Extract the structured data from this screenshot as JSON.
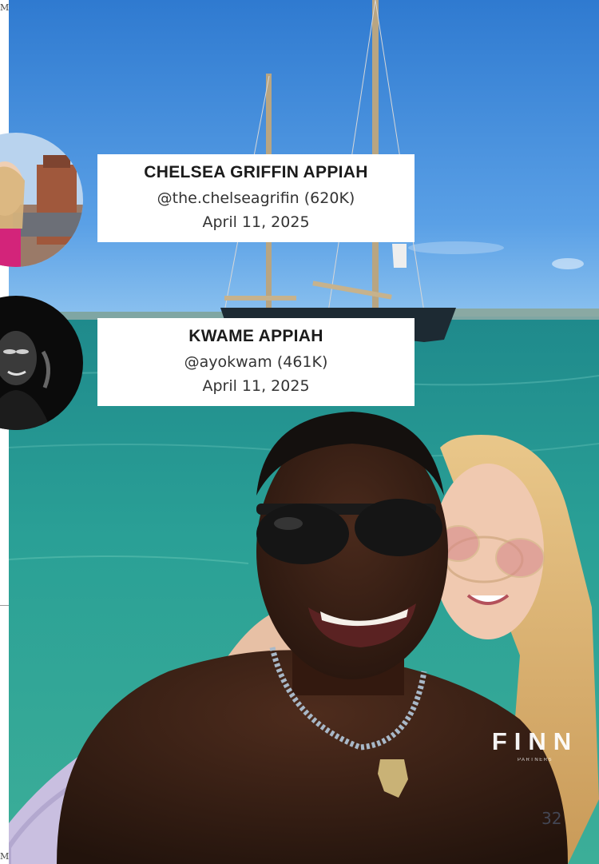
{
  "page": {
    "corner_mark_top": "M",
    "corner_mark_bottom": "M",
    "page_number": "32"
  },
  "captions": [
    {
      "name": "CHELSEA GRIFFIN APPIAH",
      "handle": "@the.chelseagrifin (620K)",
      "date": "April 11, 2025"
    },
    {
      "name": "KWAME APPIAH",
      "handle": "@ayokwam (461K)",
      "date": "April 11, 2025"
    }
  ],
  "logo": {
    "wordmark": "FINN",
    "subtext": "PARTNERS"
  },
  "colors": {
    "sky": "#3f86d6",
    "sea": "#2a9a93",
    "card_bg": "#ffffff",
    "text": "#222222"
  }
}
